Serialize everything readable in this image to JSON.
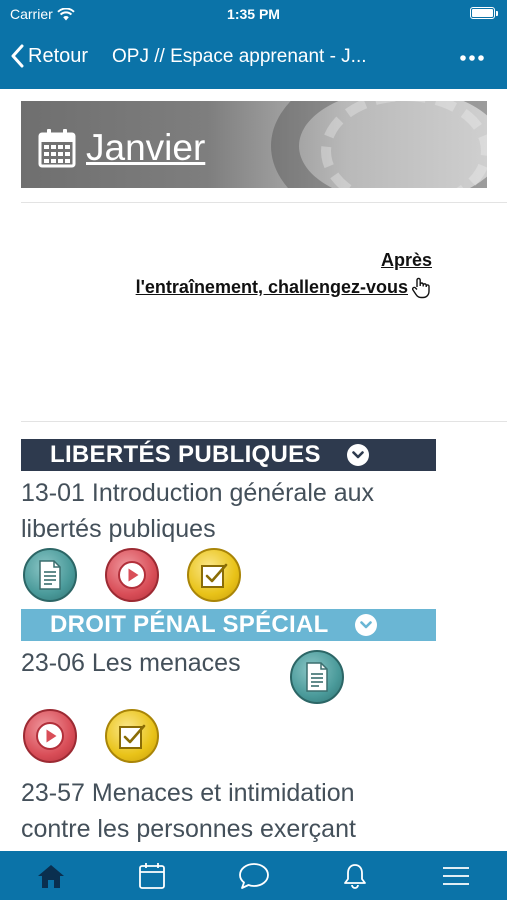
{
  "status_bar": {
    "carrier": "Carrier",
    "time": "1:35 PM"
  },
  "nav": {
    "back_label": "Retour",
    "title": "OPJ // Espace apprenant - J..."
  },
  "banner": {
    "month": "Janvier",
    "icon": "calendar-icon"
  },
  "challenge": {
    "line1": "Après",
    "line2": "l'entraînement, challengez-vous",
    "icon": "pointing-hand-icon"
  },
  "sections": [
    {
      "title": "LIBERTÉS PUBLIQUES",
      "color": "#2e3a4e"
    },
    {
      "title": "DROIT PÉNAL SPÉCIAL",
      "color": "#6ab6d4"
    }
  ],
  "courses": [
    {
      "line1": "13-01  Introduction générale aux",
      "line2": "libertés publiques"
    },
    {
      "line1": "23-06   Les menaces"
    },
    {
      "line1": "23-57   Menaces et intimidation",
      "line2": "contre les personnes exerçant"
    }
  ],
  "tabs": [
    {
      "name": "home-icon",
      "active": true
    },
    {
      "name": "calendar-icon"
    },
    {
      "name": "chat-icon"
    },
    {
      "name": "bell-icon"
    },
    {
      "name": "menu-icon"
    }
  ],
  "colors": {
    "accent": "#0b73a8",
    "active_tab": "#0a2f4f",
    "course_text": "#44505a"
  }
}
